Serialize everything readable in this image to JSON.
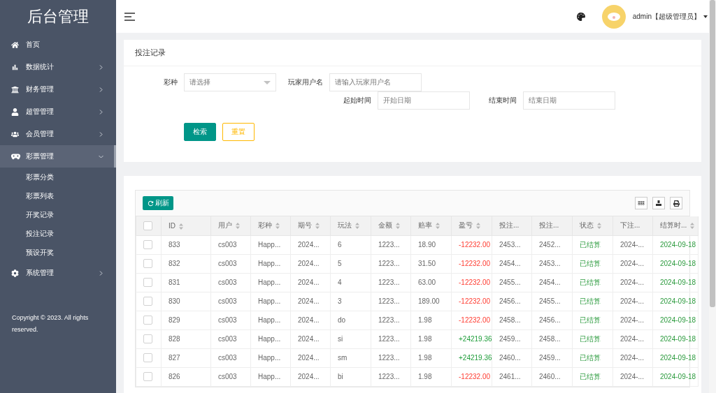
{
  "sidebar": {
    "title": "后台管理",
    "items": [
      {
        "label": "首页",
        "kind": "link",
        "selected": false
      },
      {
        "label": "数据统计",
        "kind": "group",
        "selected": false,
        "expanded": false
      },
      {
        "label": "财务管理",
        "kind": "group",
        "selected": false,
        "expanded": false
      },
      {
        "label": "超管管理",
        "kind": "group",
        "selected": false,
        "expanded": false
      },
      {
        "label": "会员管理",
        "kind": "group",
        "selected": false,
        "expanded": false
      },
      {
        "label": "彩票管理",
        "kind": "group",
        "selected": true,
        "expanded": true,
        "children": [
          {
            "label": "彩票分类"
          },
          {
            "label": "彩票列表"
          },
          {
            "label": "开奖记录"
          },
          {
            "label": "投注记录"
          },
          {
            "label": "预设开奖"
          }
        ]
      },
      {
        "label": "系统管理",
        "kind": "group",
        "selected": false,
        "expanded": false
      }
    ],
    "copyright": "Copyright © 2023. All rights reserved."
  },
  "header": {
    "user": "admin【超级管理员】"
  },
  "search_panel": {
    "title": "投注记录",
    "fields": [
      {
        "label": "彩种",
        "kind": "select",
        "placeholder": "请选择"
      },
      {
        "label": "玩家用户名",
        "kind": "input",
        "placeholder": "请输入玩家用户名"
      },
      {
        "label": "起始时间",
        "kind": "input",
        "placeholder": "开始日期"
      },
      {
        "label": "结束时间",
        "kind": "input",
        "placeholder": "结束日期"
      }
    ],
    "buttons": [
      "检索",
      "重置"
    ]
  },
  "table": {
    "refresh": "刷新",
    "all_checked": false,
    "columns": [
      {
        "label": "ID",
        "sortable": true
      },
      {
        "label": "用户",
        "sortable": true
      },
      {
        "label": "彩种",
        "sortable": true
      },
      {
        "label": "期号",
        "sortable": true
      },
      {
        "label": "玩法",
        "sortable": true
      },
      {
        "label": "金额",
        "sortable": true
      },
      {
        "label": "赔率",
        "sortable": true
      },
      {
        "label": "盈亏",
        "sortable": true
      },
      {
        "label": "投注...",
        "sortable": false
      },
      {
        "label": "投注...",
        "sortable": false
      },
      {
        "label": "状态",
        "sortable": true
      },
      {
        "label": "下注...",
        "sortable": false
      },
      {
        "label": "结算时...",
        "sortable": true
      }
    ],
    "rows": [
      {
        "checked": false,
        "cells": [
          "833",
          "cs003",
          "Happ...",
          "2024...",
          "6",
          "1223...",
          "18.90"
        ],
        "profit": {
          "text": "-12232.00",
          "kind": "loss"
        },
        "rest": [
          "2453...",
          "2452...",
          "已结算",
          "2024-...",
          "2024-09-18"
        ]
      },
      {
        "checked": false,
        "cells": [
          "832",
          "cs003",
          "Happ...",
          "2024...",
          "5",
          "1223...",
          "31.50"
        ],
        "profit": {
          "text": "-12232.00",
          "kind": "loss"
        },
        "rest": [
          "2454...",
          "2453...",
          "已结算",
          "2024-...",
          "2024-09-18"
        ]
      },
      {
        "checked": false,
        "cells": [
          "831",
          "cs003",
          "Happ...",
          "2024...",
          "4",
          "1223...",
          "63.00"
        ],
        "profit": {
          "text": "-12232.00",
          "kind": "loss"
        },
        "rest": [
          "2455...",
          "2454...",
          "已结算",
          "2024-...",
          "2024-09-18"
        ]
      },
      {
        "checked": false,
        "cells": [
          "830",
          "cs003",
          "Happ...",
          "2024...",
          "3",
          "1223...",
          "189.00"
        ],
        "profit": {
          "text": "-12232.00",
          "kind": "loss"
        },
        "rest": [
          "2456...",
          "2455...",
          "已结算",
          "2024-...",
          "2024-09-18"
        ]
      },
      {
        "checked": false,
        "cells": [
          "829",
          "cs003",
          "Happ...",
          "2024...",
          "do",
          "1223...",
          "1.98"
        ],
        "profit": {
          "text": "-12232.00",
          "kind": "loss"
        },
        "rest": [
          "2458...",
          "2456...",
          "已结算",
          "2024-...",
          "2024-09-18"
        ]
      },
      {
        "checked": false,
        "cells": [
          "828",
          "cs003",
          "Happ...",
          "2024...",
          "si",
          "1223...",
          "1.98"
        ],
        "profit": {
          "text": "+24219.36",
          "kind": "gain"
        },
        "rest": [
          "2459...",
          "2458...",
          "已结算",
          "2024-...",
          "2024-09-18"
        ]
      },
      {
        "checked": false,
        "cells": [
          "827",
          "cs003",
          "Happ...",
          "2024...",
          "sm",
          "1223...",
          "1.98"
        ],
        "profit": {
          "text": "+24219.36",
          "kind": "gain"
        },
        "rest": [
          "2460...",
          "2459...",
          "已结算",
          "2024-...",
          "2024-09-18"
        ]
      },
      {
        "checked": false,
        "cells": [
          "826",
          "cs003",
          "Happ...",
          "2024...",
          "bi",
          "1223...",
          "1.98"
        ],
        "profit": {
          "text": "-12232.00",
          "kind": "loss"
        },
        "rest": [
          "2461...",
          "2460...",
          "已结算",
          "2024-...",
          "2024-09-18"
        ]
      }
    ]
  }
}
